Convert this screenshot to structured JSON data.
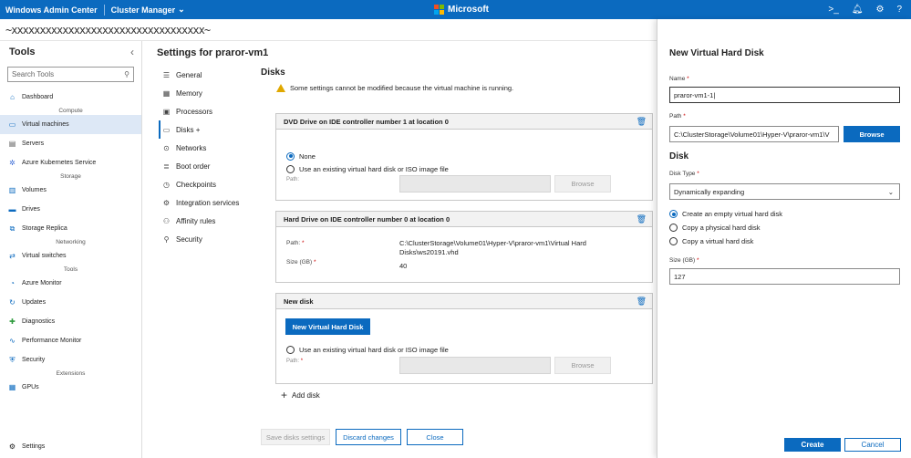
{
  "topbar": {
    "app_title": "Windows Admin Center",
    "context": "Cluster Manager",
    "brand": "Microsoft",
    "colors": {
      "bar": "#0b6abf",
      "ms_red": "#f25022",
      "ms_green": "#7fba00",
      "ms_blue": "#00a4ef",
      "ms_yellow": "#ffb900"
    }
  },
  "connection": {
    "redacted": "~xxxxxxxxxxxxxxxxxxxxxxxxxxxxxxxxxx~"
  },
  "tools": {
    "title": "Tools",
    "search_placeholder": "Search Tools",
    "items": [
      {
        "label": "Dashboard",
        "icon": "home-icon"
      },
      {
        "group": "Compute"
      },
      {
        "label": "Virtual machines",
        "icon": "monitor-icon",
        "active": true
      },
      {
        "label": "Servers",
        "icon": "server-icon"
      },
      {
        "label": "Azure Kubernetes Service",
        "icon": "kubernetes-icon"
      },
      {
        "group": "Storage"
      },
      {
        "label": "Volumes",
        "icon": "volume-icon"
      },
      {
        "label": "Drives",
        "icon": "drive-icon"
      },
      {
        "label": "Storage Replica",
        "icon": "replica-icon"
      },
      {
        "group": "Networking"
      },
      {
        "label": "Virtual switches",
        "icon": "switch-icon"
      },
      {
        "group": "Tools"
      },
      {
        "label": "Azure Monitor",
        "icon": "azure-monitor-icon"
      },
      {
        "label": "Updates",
        "icon": "updates-icon"
      },
      {
        "label": "Diagnostics",
        "icon": "diagnostics-icon"
      },
      {
        "label": "Performance Monitor",
        "icon": "perf-monitor-icon"
      },
      {
        "label": "Security",
        "icon": "shield-icon"
      },
      {
        "group": "Extensions"
      },
      {
        "label": "GPUs",
        "icon": "gpu-icon"
      }
    ],
    "settings_label": "Settings"
  },
  "settings": {
    "title": "Settings for praror-vm1",
    "nav": [
      {
        "label": "General",
        "icon": "general-icon"
      },
      {
        "label": "Memory",
        "icon": "memory-icon"
      },
      {
        "label": "Processors",
        "icon": "processor-icon"
      },
      {
        "label": "Disks +",
        "icon": "disk-icon",
        "active": true
      },
      {
        "label": "Networks",
        "icon": "network-icon"
      },
      {
        "label": "Boot order",
        "icon": "boot-order-icon"
      },
      {
        "label": "Checkpoints",
        "icon": "checkpoint-icon"
      },
      {
        "label": "Integration services",
        "icon": "integration-icon"
      },
      {
        "label": "Affinity rules",
        "icon": "affinity-icon"
      },
      {
        "label": "Security",
        "icon": "security-icon"
      }
    ]
  },
  "disks": {
    "title": "Disks",
    "warning": "Some settings cannot be modified because the virtual machine is running.",
    "dvd_card": {
      "title": "DVD Drive on IDE controller number 1 at location 0",
      "option_none": "None",
      "option_existing": "Use an existing virtual hard disk or ISO image file",
      "path_label": "Path:",
      "browse": "Browse"
    },
    "hdd_card": {
      "title": "Hard Drive on IDE controller number 0 at location 0",
      "path_label": "Path:",
      "path_value_1": "C:\\ClusterStorage\\Volume01\\Hyper-V\\praror-vm1\\Virtual Hard",
      "path_value_2": "Disks\\ws20191.vhd",
      "size_label": "Size (GB)",
      "size_value": "40"
    },
    "new_card": {
      "title": "New disk",
      "new_vhd_button": "New Virtual Hard Disk",
      "option_existing": "Use an existing virtual hard disk or ISO image file",
      "path_label": "Path:",
      "browse": "Browse"
    },
    "add_disk": "Add disk",
    "buttons": {
      "save": "Save disks settings",
      "discard": "Discard changes",
      "close": "Close"
    }
  },
  "panel": {
    "title": "New Virtual Hard Disk",
    "name_label": "Name",
    "name_value": "praror-vm1-1",
    "path_label": "Path",
    "path_value": "C:\\ClusterStorage\\Volume01\\Hyper-V\\praror-vm1\\V",
    "browse": "Browse",
    "disk_heading": "Disk",
    "disk_type_label": "Disk Type",
    "disk_type_value": "Dynamically expanding",
    "options": [
      "Create an empty virtual hard disk",
      "Copy a physical hard disk",
      "Copy a virtual hard disk"
    ],
    "size_label": "Size (GB)",
    "size_value": "127",
    "create": "Create",
    "cancel": "Cancel"
  }
}
